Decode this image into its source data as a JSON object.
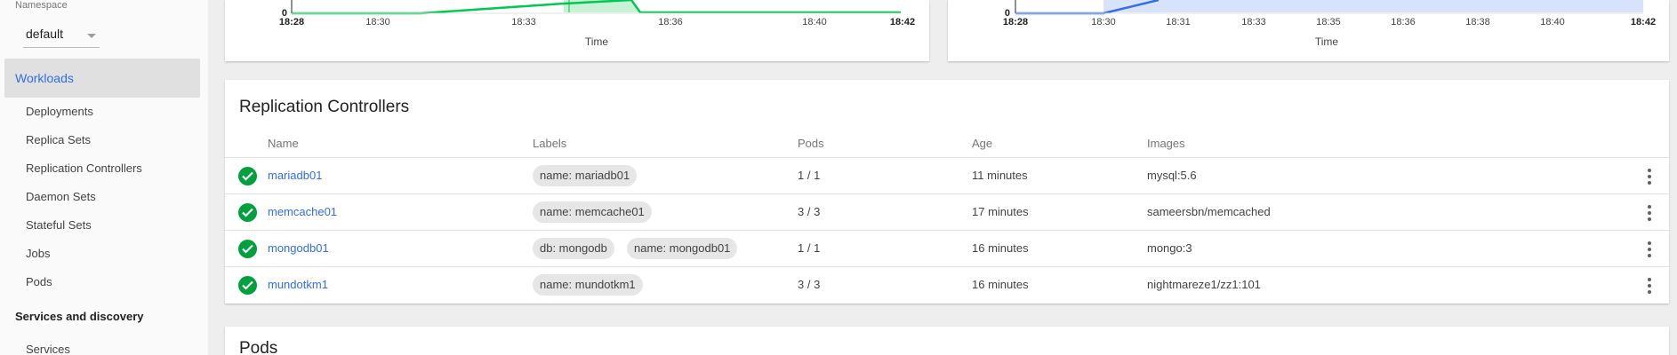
{
  "sidebar": {
    "namespace_label": "Namespace",
    "namespace_value": "default",
    "active_item": "Workloads",
    "workload_items": [
      "Deployments",
      "Replica Sets",
      "Replication Controllers",
      "Daemon Sets",
      "Stateful Sets",
      "Jobs",
      "Pods"
    ],
    "section2": "Services and discovery",
    "section2_items": [
      "Services"
    ]
  },
  "charts": [
    {
      "type": "area",
      "color": "#00c752",
      "fill": "#c8f2d5",
      "y_min_label": "0",
      "ticks": [
        {
          "label": "18:28",
          "bold": true
        },
        {
          "label": "18:30",
          "bold": false
        },
        {
          "label": "18:33",
          "bold": false
        },
        {
          "label": "18:36",
          "bold": false
        },
        {
          "label": "18:40",
          "bold": false
        },
        {
          "label": "18:42",
          "bold": true
        }
      ],
      "xlabel": "Time"
    },
    {
      "type": "area",
      "color": "#326de6",
      "fill": "#d6e3fb",
      "y_min_label": "0",
      "ticks": [
        {
          "label": "18:28",
          "bold": true
        },
        {
          "label": "18:30",
          "bold": false
        },
        {
          "label": "18:31",
          "bold": false
        },
        {
          "label": "18:33",
          "bold": false
        },
        {
          "label": "18:35",
          "bold": false
        },
        {
          "label": "18:36",
          "bold": false
        },
        {
          "label": "18:38",
          "bold": false
        },
        {
          "label": "18:40",
          "bold": false
        },
        {
          "label": "18:42",
          "bold": true
        }
      ],
      "xlabel": "Time"
    }
  ],
  "rc": {
    "title": "Replication Controllers",
    "columns": [
      "Name",
      "Labels",
      "Pods",
      "Age",
      "Images"
    ],
    "rows": [
      {
        "name": "mariadb01",
        "labels": [
          "name: mariadb01"
        ],
        "pods": "1 / 1",
        "age": "11 minutes",
        "images": "mysql:5.6"
      },
      {
        "name": "memcache01",
        "labels": [
          "name: memcache01"
        ],
        "pods": "3 / 3",
        "age": "17 minutes",
        "images": "sameersbn/memcached"
      },
      {
        "name": "mongodb01",
        "labels": [
          "db: mongodb",
          "name: mongodb01"
        ],
        "pods": "1 / 1",
        "age": "16 minutes",
        "images": "mongo:3"
      },
      {
        "name": "mundotkm1",
        "labels": [
          "name: mundotkm1"
        ],
        "pods": "3 / 3",
        "age": "16 minutes",
        "images": "nightmareze1/zz1:101"
      }
    ]
  },
  "pods": {
    "title": "Pods"
  },
  "colors": {
    "accent": "#326de6",
    "ok": "#00a03e"
  }
}
